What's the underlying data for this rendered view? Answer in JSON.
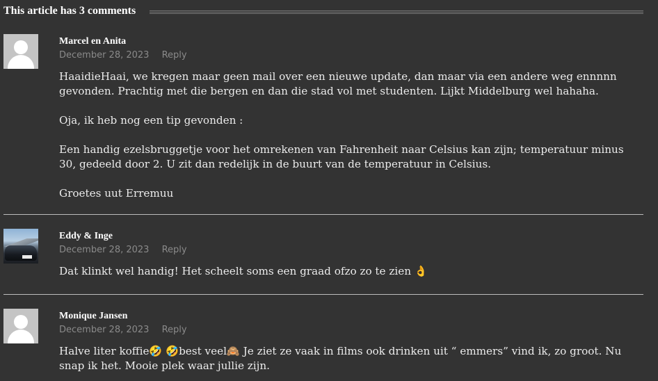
{
  "heading": "This article has 3 comments",
  "comments": [
    {
      "author": "Marcel en Anita",
      "date": "December 28, 2023",
      "reply": "Reply",
      "avatar": "default-avatar",
      "paragraphs": [
        "HaaidieHaai, we kregen maar geen mail over een nieuwe update, dan maar via een andere weg ennnnn gevonden. Prachtig met die bergen en dan die stad vol met studenten. Lijkt Middelburg wel hahaha.",
        "Oja, ik heb nog een tip gevonden :",
        "Een handig ezelsbruggetje voor het omrekenen van Fahrenheit naar Celsius kan zijn; temperatuur minus 30, gedeeld door 2. U zit dan redelijk in de buurt van de temperatuur in Celsius.",
        "Groetes uut Erremuu"
      ]
    },
    {
      "author": "Eddy & Inge",
      "date": "December 28, 2023",
      "reply": "Reply",
      "avatar": "photo-avatar-car",
      "paragraphs": [
        "Dat klinkt wel handig! Het scheelt soms een graad ofzo zo te zien 👌"
      ]
    },
    {
      "author": "Monique Jansen",
      "date": "December 28, 2023",
      "reply": "Reply",
      "avatar": "default-avatar",
      "paragraphs": [
        "Halve liter koffie🤣 🤣best veel🙈 Je ziet ze vaak in films ook drinken uit “ emmers” vind ik, zo groot. Nu snap ik het. Mooie plek waar jullie zijn."
      ]
    }
  ]
}
